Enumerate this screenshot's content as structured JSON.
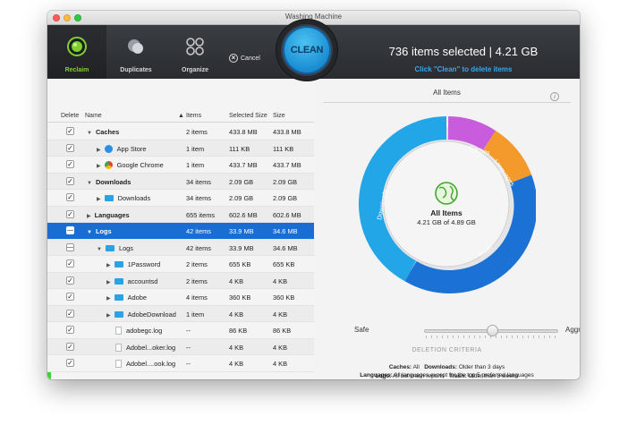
{
  "window": {
    "title": "Washing Machine"
  },
  "toolbar": {
    "reclaim_label": "Reclaim",
    "duplicates_label": "Duplicates",
    "organize_label": "Organize",
    "cancel_label": "Cancel",
    "clean_label": "CLEAN",
    "selection_summary": "736 items selected | 4.21 GB",
    "hint": "Click \"Clean\" to delete items"
  },
  "table": {
    "headers": {
      "delete": "Delete",
      "name": "Name",
      "items": "Items",
      "selected_size": "Selected Size",
      "size": "Size"
    },
    "rows": [
      {
        "name": "Caches",
        "items": "2 items",
        "selected": "433.8 MB",
        "size": "433.8 MB",
        "bold": true
      },
      {
        "name": "App Store",
        "items": "1 item",
        "selected": "111 KB",
        "size": "111 KB"
      },
      {
        "name": "Google Chrome",
        "items": "1 item",
        "selected": "433.7 MB",
        "size": "433.7 MB"
      },
      {
        "name": "Downloads",
        "items": "34 items",
        "selected": "2.09 GB",
        "size": "2.09 GB",
        "bold": true
      },
      {
        "name": "Downloads",
        "items": "34 items",
        "selected": "2.09 GB",
        "size": "2.09 GB"
      },
      {
        "name": "Languages",
        "items": "655 items",
        "selected": "602.6 MB",
        "size": "602.6 MB",
        "bold": true
      },
      {
        "name": "Logs",
        "items": "42 items",
        "selected": "33.9 MB",
        "size": "34.6 MB",
        "bold": true
      },
      {
        "name": "Logs",
        "items": "42 items",
        "selected": "33.9 MB",
        "size": "34.6 MB"
      },
      {
        "name": "1Password",
        "items": "2 items",
        "selected": "655 KB",
        "size": "655 KB"
      },
      {
        "name": "accountsd",
        "items": "2 items",
        "selected": "4 KB",
        "size": "4 KB"
      },
      {
        "name": "Adobe",
        "items": "4 items",
        "selected": "360 KB",
        "size": "360 KB"
      },
      {
        "name": "AdobeDownload",
        "items": "1 item",
        "selected": "4 KB",
        "size": "4 KB"
      },
      {
        "name": "adobegc.log",
        "items": "--",
        "selected": "86 KB",
        "size": "86 KB"
      },
      {
        "name": "Adobel...oker.log",
        "items": "--",
        "selected": "4 KB",
        "size": "4 KB"
      },
      {
        "name": "Adobel....ook.log",
        "items": "--",
        "selected": "4 KB",
        "size": "4 KB"
      }
    ]
  },
  "panel": {
    "title": "All Items",
    "info_icon": "info-icon",
    "center_title": "All Items",
    "center_value": "4.21 GB of 4.89 GB",
    "segments": {
      "downloads": "Downloads",
      "caches": "Caches",
      "languages": "Languages",
      "trash": "Trash"
    },
    "slider": {
      "left": "Safe",
      "right": "Aggressive",
      "caption": "DELETION CRITERIA"
    },
    "criteria": {
      "line1_k1": "Caches:",
      "line1_v1": "All",
      "line1_k2": "Downloads:",
      "line1_v2": "Older than 3 days",
      "line2_k": "Languages:",
      "line2_v": "All languages except for the top 5 preferred languages",
      "line3_k1": "Logs:",
      "line3_v1": "All but crash reports",
      "line3_k2": "Trash:",
      "line3_v2": "Older than 3 weeks"
    }
  },
  "colors": {
    "caches": "#c85cdc",
    "downloads": "#22a6e8",
    "languages": "#f49a2c",
    "logs": "#3fcf3a",
    "trash": "#1b72d4",
    "selection": "#1a6dd3"
  }
}
